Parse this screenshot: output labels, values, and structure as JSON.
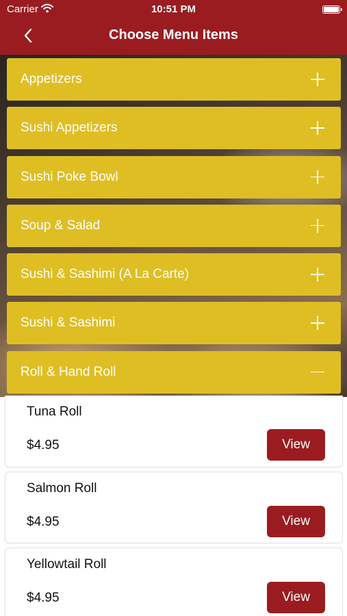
{
  "status_bar": {
    "carrier": "Carrier",
    "time": "10:51 PM"
  },
  "header": {
    "title": "Choose Menu Items"
  },
  "categories": [
    {
      "label": "Appetizers",
      "state": "collapsed"
    },
    {
      "label": "Sushi Appetizers",
      "state": "collapsed"
    },
    {
      "label": "Sushi Poke Bowl",
      "state": "collapsed"
    },
    {
      "label": "Soup & Salad",
      "state": "collapsed"
    },
    {
      "label": "Sushi & Sashimi (A La Carte)",
      "state": "collapsed"
    },
    {
      "label": "Sushi & Sashimi",
      "state": "collapsed"
    },
    {
      "label": "Roll & Hand Roll",
      "state": "expanded"
    }
  ],
  "items": [
    {
      "name": "Tuna Roll",
      "price": "$4.95",
      "action": "View"
    },
    {
      "name": "Salmon Roll",
      "price": "$4.95",
      "action": "View"
    },
    {
      "name": "Yellowtail Roll",
      "price": "$4.95",
      "action": "View"
    }
  ],
  "colors": {
    "header": "#9a1c20",
    "category": "#dfbe24",
    "button": "#9a1c20"
  },
  "icons": {
    "back": "chevron-left-icon",
    "expand": "plus-icon",
    "collapse": "minus-icon"
  }
}
